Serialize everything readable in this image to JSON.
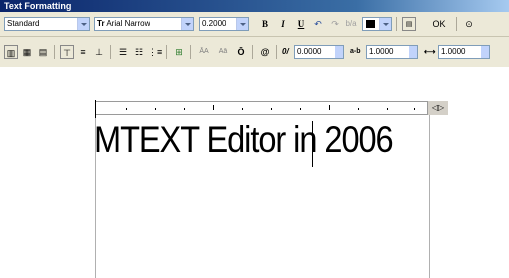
{
  "window": {
    "title": "Text Formatting"
  },
  "toolbar": {
    "style_value": "Standard",
    "font_value": "Arial Narrow",
    "font_icon": "Tr",
    "height_value": "0.2000",
    "bold": "B",
    "italic": "I",
    "underline": "U",
    "ok_label": "OK",
    "oblique_value": "0.0000",
    "tracking_label": "a-b",
    "tracking_value": "1.0000",
    "width_value": "1.0000",
    "text_upper": "ĀA",
    "text_lower": "Aā",
    "symbol": "@",
    "oblique_label": "0/"
  },
  "editor": {
    "content": "MTEXT Editor in 2006",
    "ruler_end": "◁▷"
  },
  "colors": {
    "title_bar": "#0a246a",
    "toolbar_bg": "#ece9d8"
  }
}
